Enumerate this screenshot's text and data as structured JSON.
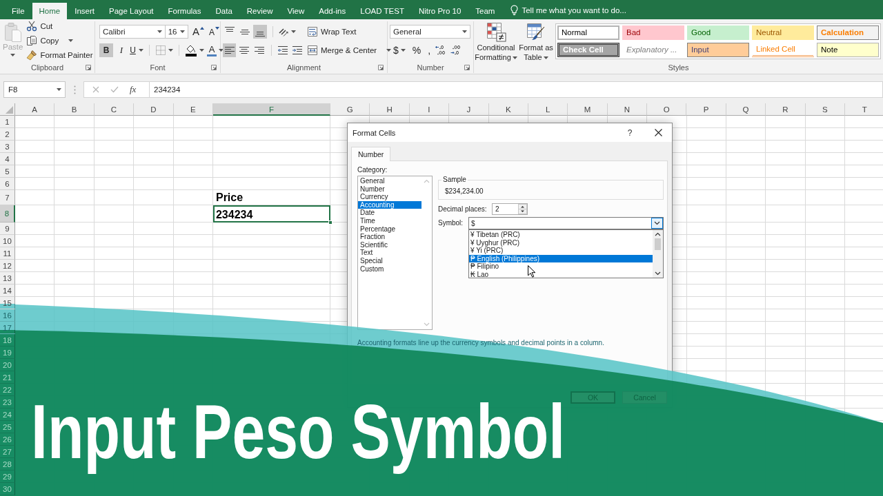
{
  "ribbon_tabs": [
    {
      "label": "File",
      "selected": false
    },
    {
      "label": "Home",
      "selected": true
    },
    {
      "label": "Insert",
      "selected": false
    },
    {
      "label": "Page Layout",
      "selected": false
    },
    {
      "label": "Formulas",
      "selected": false
    },
    {
      "label": "Data",
      "selected": false
    },
    {
      "label": "Review",
      "selected": false
    },
    {
      "label": "View",
      "selected": false
    },
    {
      "label": "Add-ins",
      "selected": false
    },
    {
      "label": "LOAD TEST",
      "selected": false
    },
    {
      "label": "Nitro Pro 10",
      "selected": false
    },
    {
      "label": "Team",
      "selected": false
    }
  ],
  "tell_me": {
    "placeholder": "Tell me what you want to do..."
  },
  "clipboard": {
    "group_label": "Clipboard",
    "paste": {
      "label": "Paste",
      "disabled": true
    },
    "commands": [
      {
        "label": "Cut",
        "kind": "cut",
        "dropdown": false
      },
      {
        "label": "Copy",
        "kind": "copy",
        "dropdown": true
      },
      {
        "label": "Format Painter",
        "kind": "painter",
        "dropdown": false
      }
    ]
  },
  "font": {
    "group_label": "Font",
    "name": "Calibri",
    "size": "16",
    "size_buttons": [
      {
        "label": "A",
        "kind": "grow"
      },
      {
        "label": "A",
        "kind": "shrink"
      }
    ],
    "style_buttons": [
      {
        "label": "B",
        "kind": "bold",
        "pressed": true,
        "dropdown": false
      },
      {
        "label": "I",
        "kind": "italic",
        "pressed": false,
        "dropdown": false
      },
      {
        "label": "U",
        "kind": "underline",
        "pressed": false,
        "dropdown": true
      }
    ],
    "font_color_label": "A"
  },
  "alignment": {
    "group_label": "Alignment",
    "vertical": [
      {
        "kind": "top",
        "pressed": false
      },
      {
        "kind": "middle",
        "pressed": false
      },
      {
        "kind": "bottom",
        "pressed": true
      }
    ],
    "horizontal": [
      {
        "kind": "left",
        "pressed": true
      },
      {
        "kind": "center",
        "pressed": false
      },
      {
        "kind": "right",
        "pressed": false
      }
    ],
    "wrap_text": "Wrap Text",
    "merge_center": "Merge & Center"
  },
  "number": {
    "group_label": "Number",
    "format": "General",
    "symbols": [
      {
        "label": "$",
        "dropdown": true
      },
      {
        "label": "%",
        "dropdown": false
      },
      {
        "label": ",",
        "dropdown": false
      }
    ]
  },
  "conditional_formatting": "Conditional Formatting",
  "format_as_table": "Format as Table",
  "styles": {
    "group_label": "Styles",
    "cells": [
      {
        "label": "Normal",
        "kind": "normal",
        "selected": true
      },
      {
        "label": "Bad",
        "kind": "bad",
        "selected": false
      },
      {
        "label": "Good",
        "kind": "good",
        "selected": false
      },
      {
        "label": "Neutral",
        "kind": "neutral",
        "selected": false
      },
      {
        "label": "Calculation",
        "kind": "calculation",
        "selected": false
      },
      {
        "label": "Check Cell",
        "kind": "check",
        "selected": false
      },
      {
        "label": "Explanatory ...",
        "kind": "explanatory",
        "selected": false
      },
      {
        "label": "Input",
        "kind": "input",
        "selected": false
      },
      {
        "label": "Linked Cell",
        "kind": "linked",
        "selected": false
      },
      {
        "label": "Note",
        "kind": "note",
        "selected": false
      }
    ]
  },
  "formula_bar": {
    "name_box": "F8",
    "function_label": "fx",
    "formula": "234234"
  },
  "sheet": {
    "columns": [
      {
        "label": "A",
        "selected": false
      },
      {
        "label": "B",
        "selected": false
      },
      {
        "label": "C",
        "selected": false
      },
      {
        "label": "D",
        "selected": false
      },
      {
        "label": "E",
        "selected": false
      },
      {
        "label": "F",
        "selected": true
      },
      {
        "label": "G",
        "selected": false
      },
      {
        "label": "H",
        "selected": false
      },
      {
        "label": "I",
        "selected": false
      },
      {
        "label": "J",
        "selected": false
      },
      {
        "label": "K",
        "selected": false
      },
      {
        "label": "L",
        "selected": false
      },
      {
        "label": "M",
        "selected": false
      },
      {
        "label": "N",
        "selected": false
      },
      {
        "label": "O",
        "selected": false
      },
      {
        "label": "P",
        "selected": false
      },
      {
        "label": "Q",
        "selected": false
      },
      {
        "label": "R",
        "selected": false
      },
      {
        "label": "S",
        "selected": false
      },
      {
        "label": "T",
        "selected": false
      }
    ],
    "rows": [
      {
        "label": "1",
        "selected": false
      },
      {
        "label": "2",
        "selected": false
      },
      {
        "label": "3",
        "selected": false
      },
      {
        "label": "4",
        "selected": false
      },
      {
        "label": "5",
        "selected": false
      },
      {
        "label": "6",
        "selected": false
      },
      {
        "label": "7",
        "selected": false
      },
      {
        "label": "8",
        "selected": true
      },
      {
        "label": "9",
        "selected": false
      },
      {
        "label": "10",
        "selected": false
      },
      {
        "label": "11",
        "selected": false
      },
      {
        "label": "12",
        "selected": false
      },
      {
        "label": "13",
        "selected": false
      },
      {
        "label": "14",
        "selected": false
      },
      {
        "label": "15",
        "selected": false
      },
      {
        "label": "16",
        "selected": false
      },
      {
        "label": "17",
        "selected": false
      },
      {
        "label": "18",
        "selected": false
      },
      {
        "label": "19",
        "selected": false
      },
      {
        "label": "20",
        "selected": false
      },
      {
        "label": "21",
        "selected": false
      },
      {
        "label": "22",
        "selected": false
      },
      {
        "label": "23",
        "selected": false
      },
      {
        "label": "24",
        "selected": false
      },
      {
        "label": "25",
        "selected": false
      },
      {
        "label": "26",
        "selected": false
      },
      {
        "label": "27",
        "selected": false
      },
      {
        "label": "28",
        "selected": false
      },
      {
        "label": "29",
        "selected": false
      },
      {
        "label": "30",
        "selected": false
      }
    ],
    "entries": [
      {
        "text": "Price",
        "selected": false
      },
      {
        "text": "234234",
        "selected": true
      }
    ]
  },
  "dialog": {
    "title": "Format Cells",
    "help": "?",
    "tabs": [
      {
        "label": "Number",
        "selected": true
      }
    ],
    "category_label": "Category:",
    "categories": [
      {
        "label": "General",
        "selected": false
      },
      {
        "label": "Number",
        "selected": false
      },
      {
        "label": "Currency",
        "selected": false
      },
      {
        "label": "Accounting",
        "selected": true
      },
      {
        "label": "Date",
        "selected": false
      },
      {
        "label": "Time",
        "selected": false
      },
      {
        "label": "Percentage",
        "selected": false
      },
      {
        "label": "Fraction",
        "selected": false
      },
      {
        "label": "Scientific",
        "selected": false
      },
      {
        "label": "Text",
        "selected": false
      },
      {
        "label": "Special",
        "selected": false
      },
      {
        "label": "Custom",
        "selected": false
      }
    ],
    "sample_label": "Sample",
    "sample_value": "$234,234.00",
    "decimal_places_label": "Decimal places:",
    "decimal_places": "2",
    "symbol_label": "Symbol:",
    "symbol": "$",
    "symbol_options": [
      {
        "label": "¥ Tibetan (PRC)",
        "selected": false
      },
      {
        "label": "¥ Uyghur (PRC)",
        "selected": false
      },
      {
        "label": "¥ Yi (PRC)",
        "selected": false
      },
      {
        "label": "₱ English (Philippines)",
        "selected": true
      },
      {
        "label": "₱ Filipino",
        "selected": false
      },
      {
        "label": "₭ Lao",
        "selected": false
      }
    ],
    "description": "Accounting formats line up the currency symbols and decimal points in a column.",
    "buttons": [
      {
        "label": "OK",
        "default": true
      },
      {
        "label": "Cancel",
        "default": false
      }
    ]
  },
  "overlay_title": "Input Peso Symbol"
}
